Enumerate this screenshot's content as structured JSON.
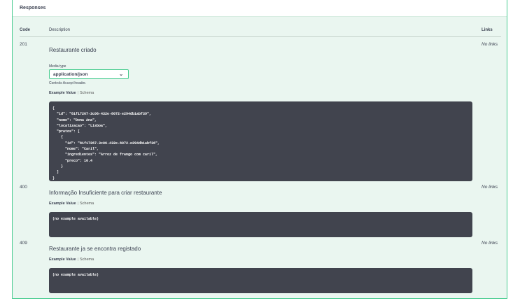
{
  "responses": {
    "title": "Responses",
    "headers": {
      "code": "Code",
      "description": "Description",
      "links": "Links"
    }
  },
  "rows": [
    {
      "code": "201",
      "description": "Restaurante criado",
      "links": "No links",
      "media_type_label": "Media type",
      "media_type_value": "application/json",
      "controls_note": "Controls Accept header.",
      "tab_example": "Example Value",
      "tab_schema": "Schema",
      "example": "{\n  \"id\": \"81f17267-3c06-432e-8072-e294db1abf39\",\n  \"nome\": \"Dona Ana\",\n  \"localizacao\": \"Lisboa\",\n  \"pratos\": [\n    {\n      \"id\": \"81f17267-3c06-432e-8072-e294db1abf36\",\n      \"nome\": \"Caril\",\n      \"ingredientes\": \"Arroz de frango com caril\",\n      \"preco\": 10.4\n    }\n  ]\n}"
    },
    {
      "code": "400",
      "description": "Informação Insuficiente para criar restaurante",
      "links": "No links",
      "tab_example": "Example Value",
      "tab_schema": "Schema",
      "example": "(no example available)"
    },
    {
      "code": "409",
      "description": "Restaurante ja se encontra registado",
      "links": "No links",
      "tab_example": "Example Value",
      "tab_schema": "Schema",
      "example": "(no example available)"
    }
  ],
  "colors": {
    "accent": "#49cc90",
    "panel_bg": "#eaf6f0",
    "code_bg": "#41444e"
  },
  "icons": {
    "media_dropdown": "chevron-down-icon"
  }
}
